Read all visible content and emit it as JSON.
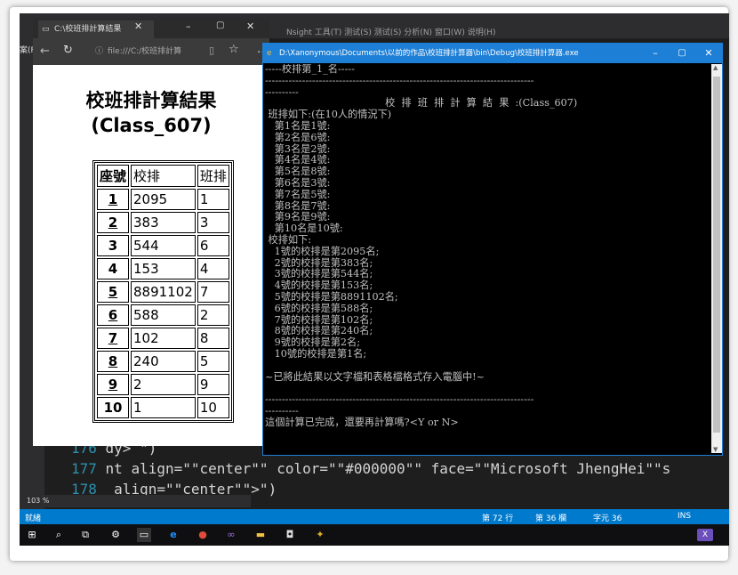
{
  "vs": {
    "menu": "Nsight   工具(T)   测试(S)   测试(S)   分析(N)   窗口(W)   说明(H)",
    "left_label": "案(F",
    "code_lines": [
      {
        "num": "176",
        "text": " dy> \")"
      },
      {
        "num": "177",
        "text": " nt align=\"\"center\"\" color=\"\"#000000\"\" face=\"\"Microsoft JhengHei\"\"s"
      },
      {
        "num": "178",
        "text": "  align=\"\"center\"\">\")"
      }
    ],
    "zoom": "103 %",
    "status": {
      "ready": "就緒",
      "row": "第 72 行",
      "col": "第 36 欄",
      "char": "字元 36",
      "mode": "INS"
    }
  },
  "edge": {
    "tab_title": "C:\\校班排計算結果",
    "address": "file:///C:/校班排計算",
    "page_title_line1": "校班排計算結果",
    "page_title_line2": "(Class_607)",
    "table_headers": [
      "座號",
      "校排",
      "班排"
    ],
    "table_rows": [
      {
        "seat": "1",
        "school": "2095",
        "class": "1"
      },
      {
        "seat": "2",
        "school": "383",
        "class": "3"
      },
      {
        "seat": "3",
        "school": "544",
        "class": "6"
      },
      {
        "seat": "4",
        "school": "153",
        "class": "4"
      },
      {
        "seat": "5",
        "school": "8891102",
        "class": "7"
      },
      {
        "seat": "6",
        "school": "588",
        "class": "2"
      },
      {
        "seat": "7",
        "school": "102",
        "class": "8"
      },
      {
        "seat": "8",
        "school": "240",
        "class": "5"
      },
      {
        "seat": "9",
        "school": "2",
        "class": "9"
      },
      {
        "seat": "10",
        "school": "1",
        "class": "10"
      }
    ]
  },
  "console": {
    "title": "D:\\Xanonymous\\Documents\\以前的作品\\校班排計算器\\bin\\Debug\\校班排計算器.exe",
    "lines": [
      "-----校排第_1_名-----",
      "--------------------------------------------------------------------------------",
      "----------",
      "                                      校  排  班  排  計  算  結  果  :(Class_607)",
      " 班排如下:(在10人的情況下)",
      "   第1名是1號:",
      "   第2名是6號:",
      "   第3名是2號:",
      "   第4名是4號:",
      "   第5名是8號:",
      "   第6名是3號:",
      "   第7名是5號:",
      "   第8名是7號:",
      "   第9名是9號:",
      "   第10名是10號:",
      " 校排如下:",
      "   1號的校排是第2095名;",
      "   2號的校排是第383名;",
      "   3號的校排是第544名;",
      "   4號的校排是第153名;",
      "   5號的校排是第8891102名;",
      "   6號的校排是第588名;",
      "   7號的校排是第102名;",
      "   8號的校排是第240名;",
      "   9號的校排是第2名;",
      "   10號的校排是第1名;",
      "",
      "~已將此結果以文字檔和表格檔格式存入電腦中!~",
      "",
      "--------------------------------------------------------------------------------",
      "----------",
      "這個計算已完成，還要再計算嗎?<Y or N>"
    ]
  }
}
